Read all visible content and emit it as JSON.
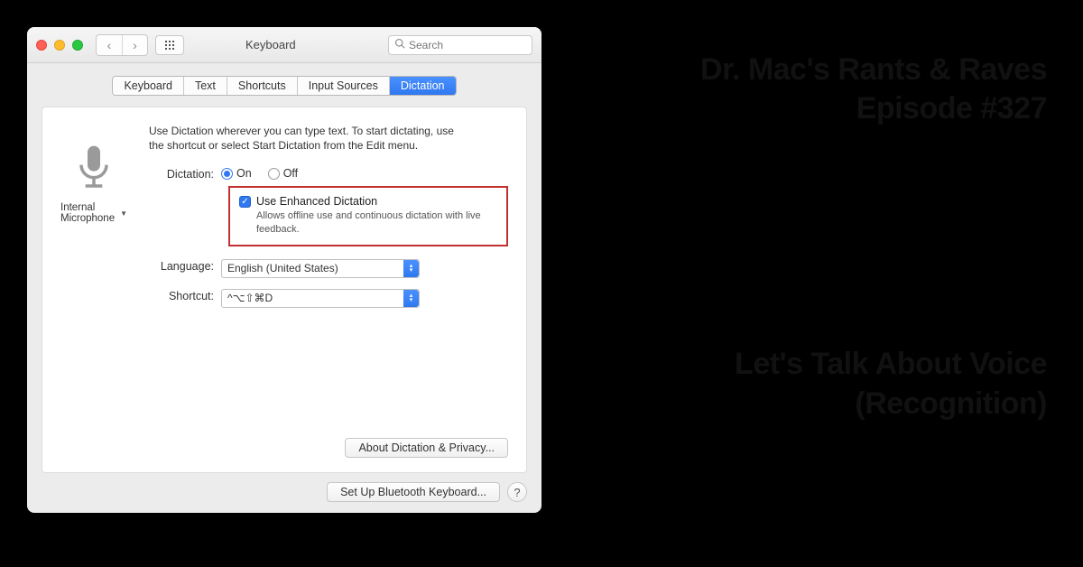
{
  "window": {
    "title": "Keyboard",
    "search_placeholder": "Search"
  },
  "tabs": [
    "Keyboard",
    "Text",
    "Shortcuts",
    "Input Sources",
    "Dictation"
  ],
  "active_tab_index": 4,
  "mic": {
    "label": "Internal Microphone"
  },
  "hint": "Use Dictation wherever you can type text. To start dictating, use the shortcut or select Start Dictation from the Edit menu.",
  "form": {
    "dictation_label": "Dictation:",
    "on_label": "On",
    "off_label": "Off",
    "dictation_on": true,
    "enhanced_label": "Use Enhanced Dictation",
    "enhanced_sub": "Allows offline use and continuous dictation with live feedback.",
    "language_label": "Language:",
    "language_value": "English (United States)",
    "shortcut_label": "Shortcut:",
    "shortcut_value": "^⌥⇧⌘D"
  },
  "buttons": {
    "about": "About Dictation & Privacy...",
    "bluetooth": "Set Up Bluetooth Keyboard...",
    "help": "?"
  },
  "article": {
    "line1": "Dr. Mac's Rants & Raves",
    "line2": "Episode #327",
    "line3": "Let's Talk About Voice",
    "line4": "(Recognition)"
  }
}
